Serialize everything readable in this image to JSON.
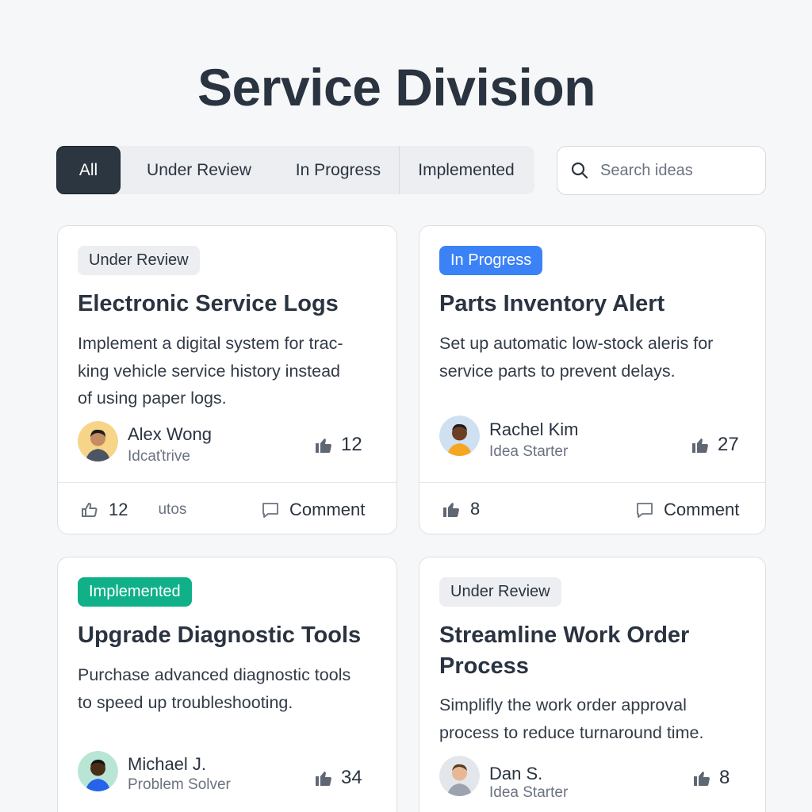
{
  "page": {
    "title": "Service Division"
  },
  "filters": {
    "tabs": [
      "All",
      "Under Review",
      "In Progress",
      "Implemented"
    ],
    "active": "All"
  },
  "search": {
    "placeholder": "Search ideas",
    "icon": "search-icon"
  },
  "cards": [
    {
      "status": "Under Review",
      "title": "Electronic Service Logs",
      "desc_lines": [
        "Implement a digital system for trac-",
        "king vehicle service history instead",
        "of using paper logs."
      ],
      "author": "Alex Wong",
      "role": "Idcaťtrive",
      "votes": "12",
      "footer_count": "12",
      "footer_label": "utos",
      "comment_label": "Comment"
    },
    {
      "status": "In Progress",
      "title": "Parts Inventory Alert",
      "desc_lines": [
        "Set up automatic low-stock aleris for",
        "service parts to prevent delays."
      ],
      "author": "Rachel Kim",
      "role": "Idea Starter",
      "votes": "27",
      "footer_count": "8",
      "comment_label": "Comment"
    },
    {
      "status": "Implemented",
      "title": "Upgrade Diagnostic Tools",
      "desc_lines": [
        "Purchase advanced diagnostic tools",
        "to speed up troubleshooting."
      ],
      "author": "Michael J.",
      "role": "Problem Solver",
      "votes": "34"
    },
    {
      "status": "Under Review",
      "title_lines": [
        "Streamline Work Order",
        "Process"
      ],
      "desc_lines": [
        "Simplifly the work order approval",
        "process to reduce turnaround time."
      ],
      "author": "Dan S.",
      "role": "Idea Starter",
      "votes": "8"
    }
  ],
  "colors": {
    "active_tab": "#2b3640",
    "in_progress": "#3b82f6",
    "implemented": "#10b088",
    "under_review": "#eceef1"
  }
}
